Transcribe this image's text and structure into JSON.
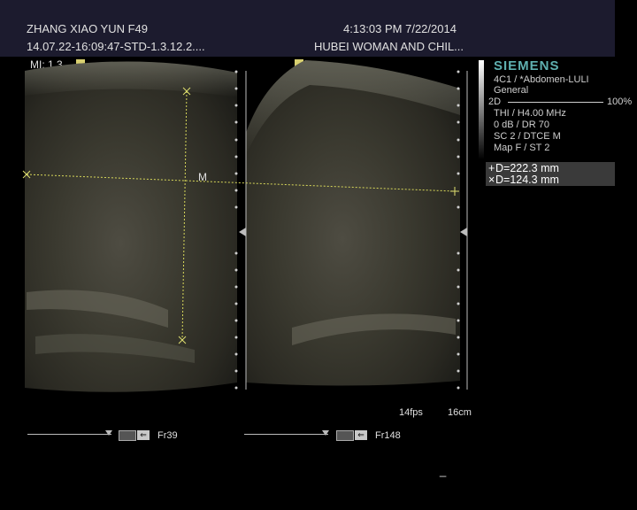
{
  "header": {
    "patient": "ZHANG XIAO YUN  F49",
    "datetime": "4:13:03 PM 7/22/2014",
    "study_id": "14.07.22-16:09:47-STD-1.3.12.2....",
    "institution": "HUBEI WOMAN AND CHIL...",
    "mi": "MI:  1.3"
  },
  "side": {
    "brand": "SIEMENS",
    "probe": "4C1 / *Abdomen-LULI",
    "preset": "General",
    "mode": "2D",
    "power": "100%",
    "thi": "THI / H4.00 MHz",
    "gain": "0 dB / DR 70",
    "sc": "SC 2 / DTCE M",
    "map": "Map F / ST 2"
  },
  "measurements": [
    {
      "symbol": "+",
      "label": "D=222.3 mm"
    },
    {
      "symbol": "×",
      "label": "D=124.3 mm"
    }
  ],
  "image": {
    "caliper_label": "M",
    "fps": "14fps",
    "depth": "16cm",
    "left_frame": "Fr39",
    "right_frame": "Fr148",
    "cursor_mark": "_"
  },
  "colors": {
    "header_bg": "#1c1b2e",
    "caliper": "#d8d85a",
    "brand": "#5fb0b0"
  }
}
